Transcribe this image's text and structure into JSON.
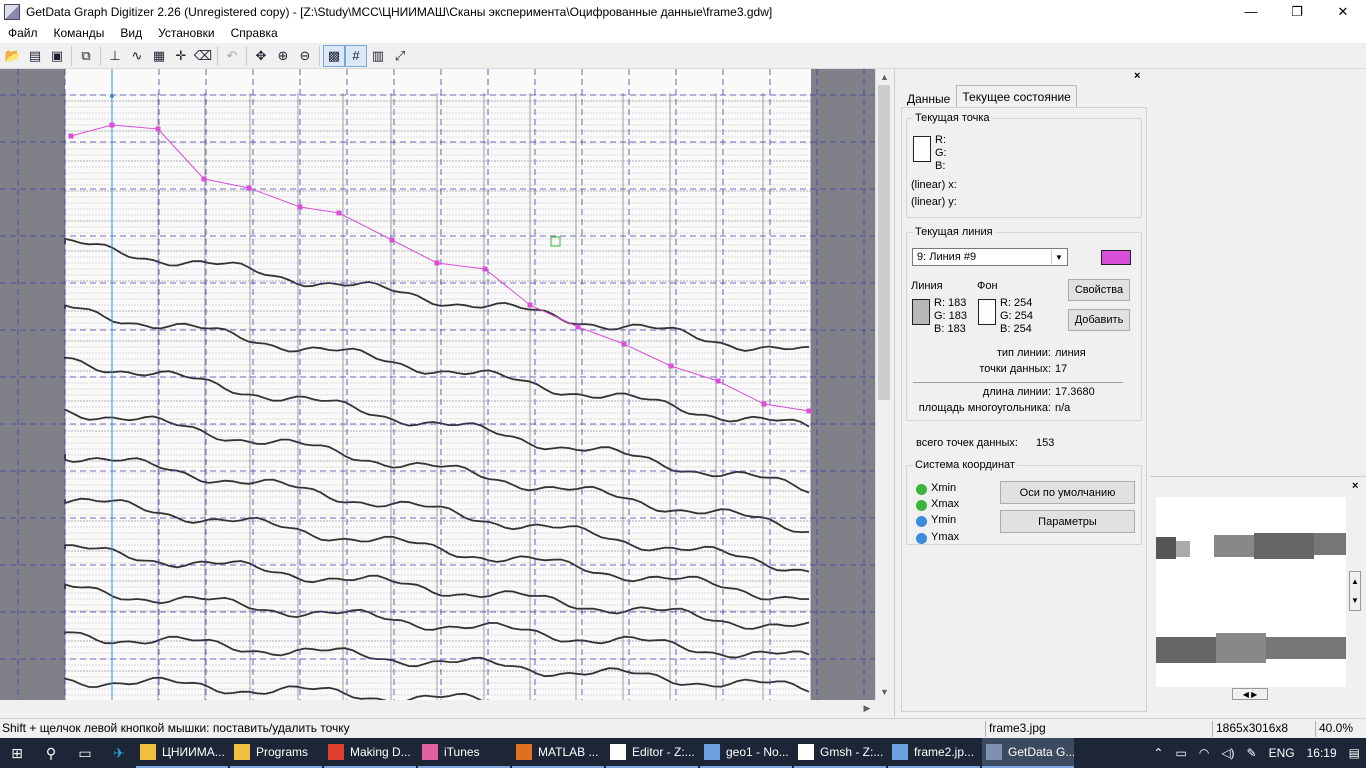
{
  "window": {
    "title": "GetData Graph Digitizer 2.26 (Unregistered copy) - [Z:\\Study\\МСС\\ЦНИИМАШ\\Сканы эксперимента\\Оцифрованные данные\\frame3.gdw]",
    "minimize": "—",
    "maximize": "❐",
    "close": "✕"
  },
  "menu": {
    "items": [
      "Файл",
      "Команды",
      "Вид",
      "Установки",
      "Справка"
    ]
  },
  "panel": {
    "close": "×",
    "tabs": [
      "Данные",
      "Текущее состояние"
    ],
    "current_point": {
      "legend": "Текущая точка",
      "r": "R:",
      "g": "G:",
      "b": "B:",
      "x_label": "(linear)  x:",
      "y_label": "(linear)  y:"
    },
    "current_line": {
      "legend": "Текущая линия",
      "selected": "9: Линия #9",
      "line_color": "#d94fd9",
      "line_label": "Линия",
      "bg_label": "Фон",
      "line_r": "R: 183",
      "line_g": "G: 183",
      "line_b": "B: 183",
      "bg_r": "R: 254",
      "bg_g": "G: 254",
      "bg_b": "B: 254",
      "props_button": "Свойства",
      "add_button": "Добавить",
      "line_type_label": "тип линии:",
      "line_type_value": "линия",
      "points_label": "точки данных:",
      "points_value": "17",
      "length_label": "длина линии:",
      "length_value": "17.3680",
      "area_label": "площадь многоугольника:",
      "area_value": "n/a"
    },
    "total_points_label": "всего точек данных:",
    "total_points_value": "153",
    "coords": {
      "legend": "Система координат",
      "xmin": "Xmin",
      "xmax": "Xmax",
      "ymin": "Ymin",
      "ymax": "Ymax",
      "xcolor": "#3cb43c",
      "ycolor": "#3c8ce0",
      "default_axes_button": "Оси по умолчанию",
      "params_button": "Параметры"
    }
  },
  "status": {
    "hint": "Shift + щелчок левой кнопкой мышки: поставить/удалить точку",
    "file": "frame3.jpg",
    "size": "1865x3016x8",
    "zoom": "40.0%"
  },
  "taskbar": {
    "apps": [
      {
        "label": "ЦНИИМА...",
        "color": "#f0c040"
      },
      {
        "label": "Programs",
        "color": "#f0c040"
      },
      {
        "label": "Making D...",
        "color": "#e04030"
      },
      {
        "label": "iTunes",
        "color": "#e060a0"
      },
      {
        "label": "MATLAB ...",
        "color": "#e07020"
      },
      {
        "label": "Editor - Z:...",
        "color": "#ffffff"
      },
      {
        "label": "geo1 - No...",
        "color": "#6aa0e0"
      },
      {
        "label": "Gmsh - Z:...",
        "color": "#ffffff"
      },
      {
        "label": "frame2.jp...",
        "color": "#6aa0e0"
      },
      {
        "label": "GetData G...",
        "color": "#8090b0"
      }
    ],
    "lang": "ENG",
    "time": "16:19"
  }
}
